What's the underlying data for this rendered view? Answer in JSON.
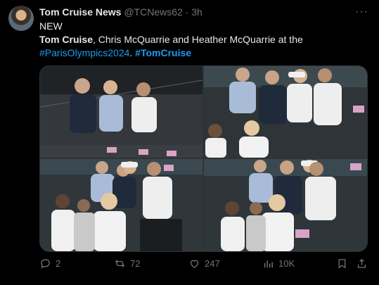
{
  "tweet": {
    "author_name": "Tom Cruise News",
    "author_handle": "@TCNews62",
    "separator": "·",
    "time": "3h",
    "line1": "NEW",
    "line2_bold": "Tom Cruise",
    "line2_rest": ", Chris McQuarrie and Heather McQuarrie at the",
    "hashtag1": "#ParisOlympics2024",
    "line3_mid": ". ",
    "hashtag2": "#TomCruise",
    "more_icon": "ellipsis-icon"
  },
  "media": {
    "photo_count": 4
  },
  "actions": {
    "replies": "2",
    "reposts": "72",
    "likes": "247",
    "views": "10K",
    "icons": [
      "reply-icon",
      "repost-icon",
      "like-icon",
      "views-icon",
      "bookmark-icon",
      "share-icon"
    ]
  },
  "colors": {
    "background": "#000000",
    "text": "#e7e9ea",
    "muted": "#71767b",
    "link": "#1d9bf0"
  }
}
